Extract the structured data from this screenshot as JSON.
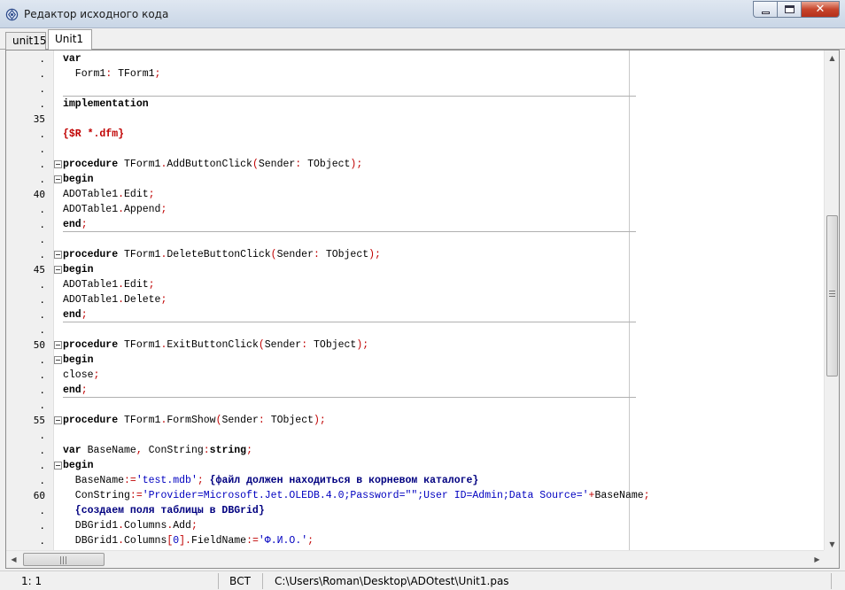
{
  "window": {
    "title": "Редактор исходного кода",
    "icon": "gear-app-icon",
    "controls": {
      "minimize": "minimize-icon",
      "maximize": "maximize-icon",
      "close": "✕"
    }
  },
  "tabs": [
    {
      "label": "unit15",
      "active": false
    },
    {
      "label": "Unit1",
      "active": true
    }
  ],
  "gutter": [
    ".",
    ".",
    ".",
    ".",
    "35",
    ".",
    ".",
    ".",
    ".",
    "40",
    ".",
    ".",
    ".",
    ".",
    "45",
    ".",
    ".",
    ".",
    ".",
    "50",
    ".",
    ".",
    ".",
    ".",
    "55",
    ".",
    ".",
    ".",
    ".",
    "60",
    ".",
    ".",
    "."
  ],
  "code": {
    "l1": "var",
    "l2a": "  Form1",
    "l2b": ": ",
    "l2c": "TForm1",
    "l2d": ";",
    "l4": "implementation",
    "l6": "{$R *.dfm}",
    "l8a": "procedure ",
    "l8b": "TForm1",
    "l8c": ".",
    "l8d": "AddButtonClick",
    "l8e": "(",
    "l8f": "Sender",
    "l8g": ": ",
    "l8h": "TObject",
    "l8i": ");",
    "l9": "begin",
    "l10a": "ADOTable1",
    "l10b": ".",
    "l10c": "Edit",
    "l10d": ";",
    "l11a": "ADOTable1",
    "l11b": ".",
    "l11c": "Append",
    "l11d": ";",
    "l12a": "end",
    "l12b": ";",
    "l14a": "procedure ",
    "l14b": "TForm1",
    "l14c": ".",
    "l14d": "DeleteButtonClick",
    "l14e": "(",
    "l14f": "Sender",
    "l14g": ": ",
    "l14h": "TObject",
    "l14i": ");",
    "l15": "begin",
    "l16a": "ADOTable1",
    "l16b": ".",
    "l16c": "Edit",
    "l16d": ";",
    "l17a": "ADOTable1",
    "l17b": ".",
    "l17c": "Delete",
    "l17d": ";",
    "l18a": "end",
    "l18b": ";",
    "l20a": "procedure ",
    "l20b": "TForm1",
    "l20c": ".",
    "l20d": "ExitButtonClick",
    "l20e": "(",
    "l20f": "Sender",
    "l20g": ": ",
    "l20h": "TObject",
    "l20i": ");",
    "l21": "begin",
    "l22a": "close",
    "l22b": ";",
    "l23a": "end",
    "l23b": ";",
    "l25a": "procedure ",
    "l25b": "TForm1",
    "l25c": ".",
    "l25d": "FormShow",
    "l25e": "(",
    "l25f": "Sender",
    "l25g": ": ",
    "l25h": "TObject",
    "l25i": ");",
    "l27a": "var ",
    "l27b": "BaseName",
    "l27c": ", ",
    "l27d": "ConString",
    "l27e": ":",
    "l27f": "string",
    "l27g": ";",
    "l28": "begin",
    "l29a": "  BaseName",
    "l29b": ":=",
    "l29c": "'test.mdb'",
    "l29d": "; ",
    "l29e": "{файл должен находиться в корневом каталоге}",
    "l30a": "  ConString",
    "l30b": ":=",
    "l30c": "'Provider=Microsoft.Jet.OLEDB.4.0;Password=\"\";User ID=Admin;Data Source='",
    "l30d": "+",
    "l30e": "BaseName",
    "l30f": ";",
    "l31": "  {создаем поля таблицы в DBGrid}",
    "l32a": "  DBGrid1",
    "l32b": ".",
    "l32c": "Columns",
    "l32d": ".",
    "l32e": "Add",
    "l32f": ";",
    "l33a": "  DBGrid1",
    "l33b": ".",
    "l33c": "Columns",
    "l33d": "[",
    "l33e": "0",
    "l33f": "].",
    "l33g": "FieldName",
    "l33h": ":=",
    "l33i": "'Ф.И.О.'",
    "l33j": ";"
  },
  "status": {
    "position": "1:  1",
    "mode": "ВСТ",
    "path": "C:\\Users\\Roman\\Desktop\\ADOtest\\Unit1.pas"
  },
  "colors": {
    "keyword": "#000000",
    "symbol": "#c00000",
    "string": "#0000c0",
    "comment": "#000080"
  }
}
